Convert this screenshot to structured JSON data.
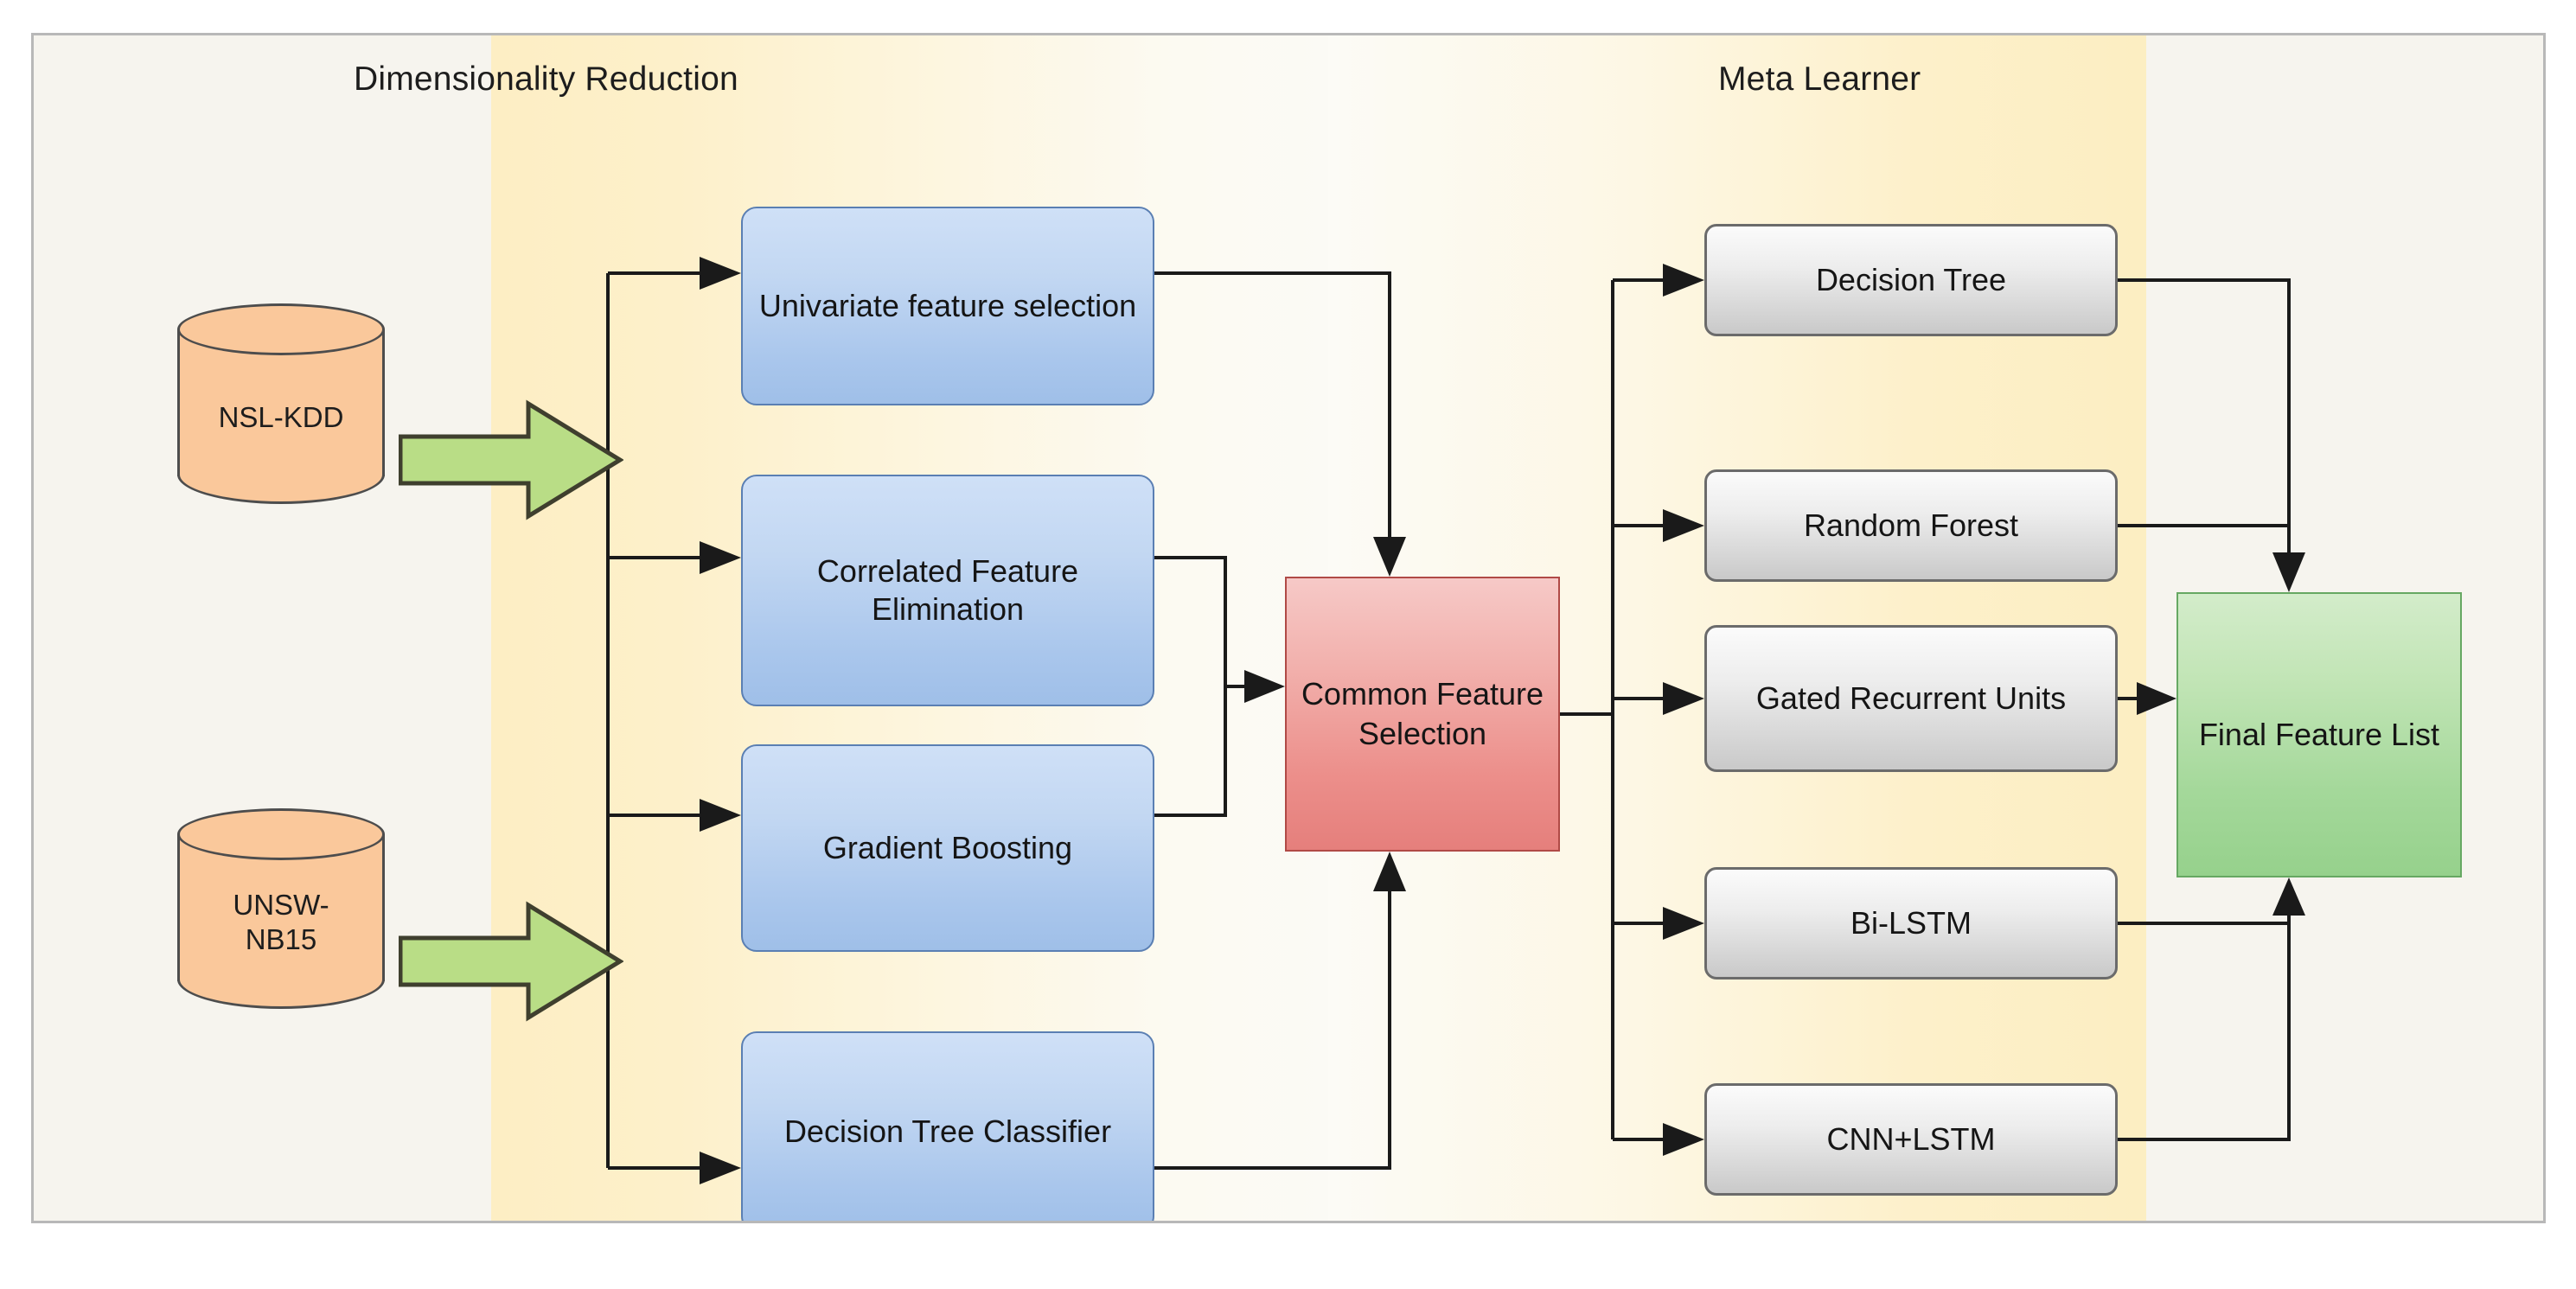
{
  "diagram": {
    "sections": {
      "dimensionality_reduction": "Dimensionality Reduction",
      "meta_learner": "Meta Learner"
    },
    "datasets": [
      {
        "id": "nsl-kdd",
        "label": "NSL-KDD"
      },
      {
        "id": "unsw-nb15",
        "label": "UNSW-\nNB15"
      }
    ],
    "feature_selectors": [
      {
        "id": "univariate-feature-selection",
        "label": "Univariate feature selection"
      },
      {
        "id": "correlated-feature-elimination",
        "label": "Correlated Feature Elimination"
      },
      {
        "id": "gradient-boosting",
        "label": "Gradient Boosting"
      },
      {
        "id": "decision-tree-classifier",
        "label": "Decision Tree Classifier"
      }
    ],
    "common_feature_selection": {
      "id": "common-feature-selection",
      "label": "Common Feature Selection"
    },
    "meta_learners": [
      {
        "id": "decision-tree",
        "label": "Decision Tree"
      },
      {
        "id": "random-forest",
        "label": "Random Forest"
      },
      {
        "id": "gated-recurrent-units",
        "label": "Gated Recurrent Units"
      },
      {
        "id": "bi-lstm",
        "label": "Bi-LSTM"
      },
      {
        "id": "cnn-lstm",
        "label": "CNN+LSTM"
      }
    ],
    "final_output": {
      "id": "final-feature-list",
      "label": "Final Feature List"
    },
    "colors": {
      "canvas_background": "#f6f4ee",
      "band_yellow": "#fdeec4",
      "dataset_fill": "#fac89b",
      "dataset_stroke": "#4d4d4d",
      "process_fill": "#c2d7f2",
      "process_stroke": "#5a7fb3",
      "meta_fill": "#ededed",
      "meta_stroke": "#6b6b6b",
      "common_fill": "#ec8f8b",
      "common_stroke": "#b04a46",
      "final_fill": "#a4d89a",
      "final_stroke": "#66a862",
      "arrow_green_fill": "#b9dd86",
      "arrow_green_stroke": "#3f3f2e",
      "connector_line": "#1a1a1a"
    }
  }
}
